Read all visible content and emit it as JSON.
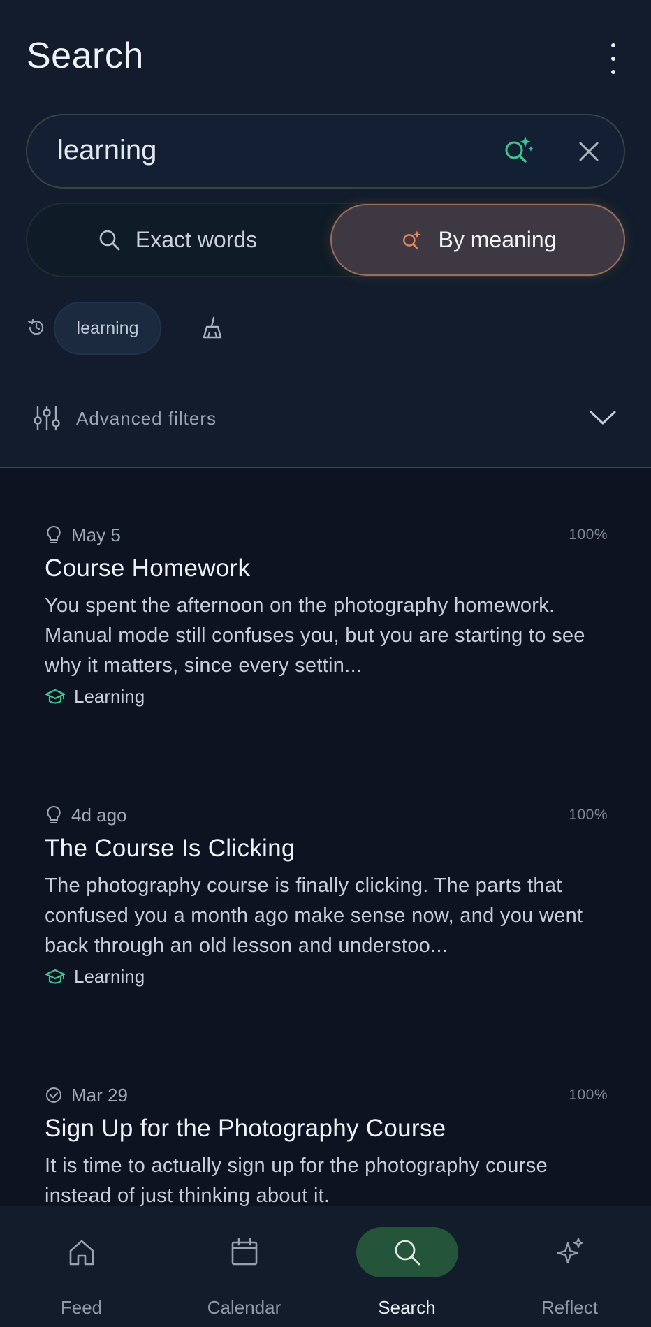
{
  "header": {
    "title": "Search",
    "more_icon": "more-vertical-icon"
  },
  "search": {
    "value": "learning",
    "semantic_icon": "sparkle-search-icon",
    "clear_icon": "close-icon"
  },
  "mode_toggle": {
    "exact_label": "Exact words",
    "meaning_label": "By meaning",
    "selected": "By meaning",
    "accent_color": "#e8845a"
  },
  "recent": {
    "history_icon": "history-icon",
    "chips": [
      "learning"
    ],
    "clear_icon": "broom-icon"
  },
  "filters": {
    "label": "Advanced filters",
    "icon": "sliders-icon",
    "chevron": "chevron-down-icon"
  },
  "results": [
    {
      "type_icon": "lightbulb-icon",
      "date": "May 5",
      "score": "100%",
      "title": "Course Homework",
      "body": "You spent the afternoon on the photography homework. Manual mode still confuses you, but you are starting to see why it matters, since every settin...",
      "tag": "Learning",
      "tag_icon": "graduation-cap-icon"
    },
    {
      "type_icon": "lightbulb-icon",
      "date": "4d ago",
      "score": "100%",
      "title": "The Course Is Clicking",
      "body": "The photography course is finally clicking. The parts that confused you a month ago make sense now, and you went back through an old lesson and understoo...",
      "tag": "Learning",
      "tag_icon": "graduation-cap-icon"
    },
    {
      "type_icon": "check-circle-icon",
      "date": "Mar 29",
      "score": "100%",
      "title": "Sign Up for the Photography Course",
      "body": "It is time to actually sign up for the photography course instead of just thinking about it.",
      "tag": "",
      "tag_icon": ""
    }
  ],
  "bottom_nav": {
    "items": [
      {
        "label": "Feed",
        "icon": "home-icon"
      },
      {
        "label": "Calendar",
        "icon": "calendar-icon"
      },
      {
        "label": "Search",
        "icon": "search-icon"
      },
      {
        "label": "Reflect",
        "icon": "sparkle-icon"
      }
    ],
    "active": "Search",
    "active_color": "#245439"
  }
}
